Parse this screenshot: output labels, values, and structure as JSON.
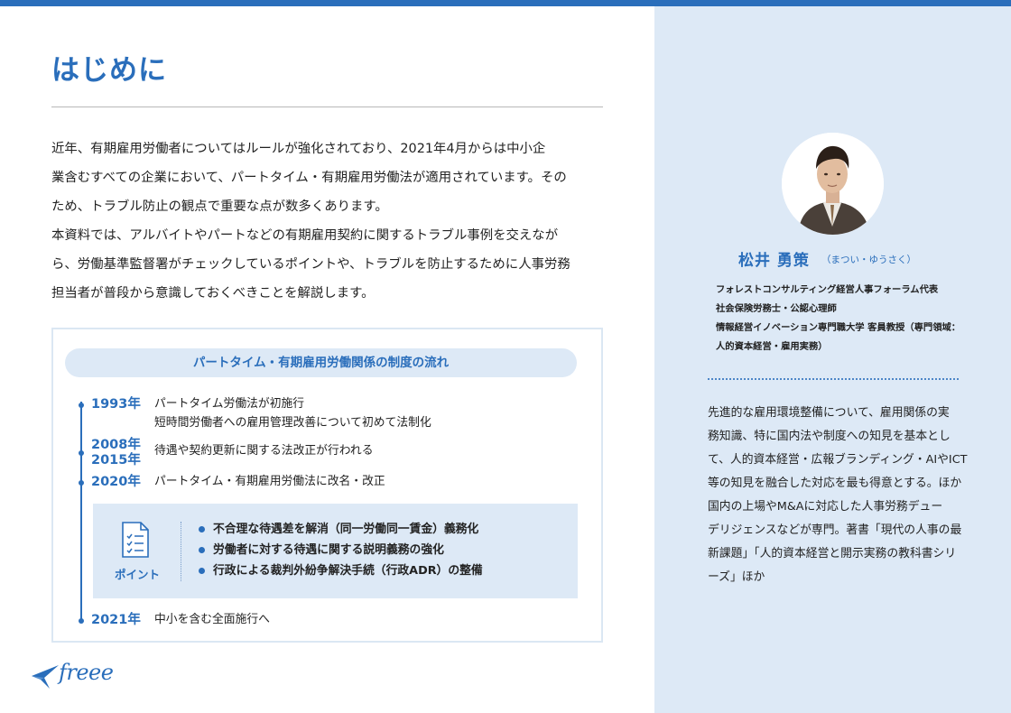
{
  "page": {
    "title": "はじめに"
  },
  "intro": {
    "paragraph1": "近年、有期雇用労働者についてはルールが強化されており、2021年4月からは中小企\n業含むすべての企業において、パートタイム・有期雇用労働法が適用されています。その\nため、トラブル防止の観点で重要な点が数多くあります。",
    "paragraph2": "本資料では、アルバイトやパートなどの有期雇用契約に関するトラブル事例を交えなが\nら、労働基準監督署がチェックしているポイントや、トラブルを防止するために人事労務\n担当者が普段から意識しておくべきことを解説します。"
  },
  "flow": {
    "title": "パートタイム・有期雇用労働関係の制度の流れ",
    "timeline": [
      {
        "year": "1993年",
        "text": "パートタイム労働法が初施行\n短時間労働者への雇用管理改善について初めて法制化"
      },
      {
        "year": "2008年\n2015年",
        "text": "待遇や契約更新に関する法改正が行われる"
      },
      {
        "year": "2020年",
        "text": "パートタイム・有期雇用労働法に改名・改正"
      },
      {
        "year": "2021年",
        "text": "中小を含む全面施行へ"
      }
    ],
    "points": {
      "label": "ポイント",
      "icon": "checklist-document-icon",
      "items": [
        "不合理な待遇差を解消（同一労働同一賃金）義務化",
        "労働者に対する待遇に関する説明義務の強化",
        "行政による裁判外紛争解決手続（行政ADR）の整備"
      ]
    }
  },
  "logo": {
    "text": "freee",
    "icon": "freee-bird-icon"
  },
  "profile": {
    "name": "松井 勇策",
    "reading": "（まつい・ゆうさく）",
    "titles": [
      "フォレストコンサルティング経営人事フォーラム代表",
      "社会保険労務士・公認心理師",
      "情報経営イノベーション専門職大学 客員教授（専門領域：\n人的資本経営・雇用実務）"
    ],
    "bio": "先進的な雇用環境整備について、雇用関係の実\n務知識、特に国内法や制度への知見を基本とし\nて、人的資本経営・広報ブランディング・AIやICT\n等の知見を融合した対応を最も得意とする。ほか\n国内の上場やM&Aに対応した人事労務デュー\nデリジェンスなどが専門。著書「現代の人事の最\n新課題」「人的資本経営と開示実務の教科書シリ\nーズ」ほか"
  },
  "colors": {
    "accent": "#2a6ebb",
    "sidebar": "#dde9f6",
    "point_box": "#dde9f6"
  }
}
